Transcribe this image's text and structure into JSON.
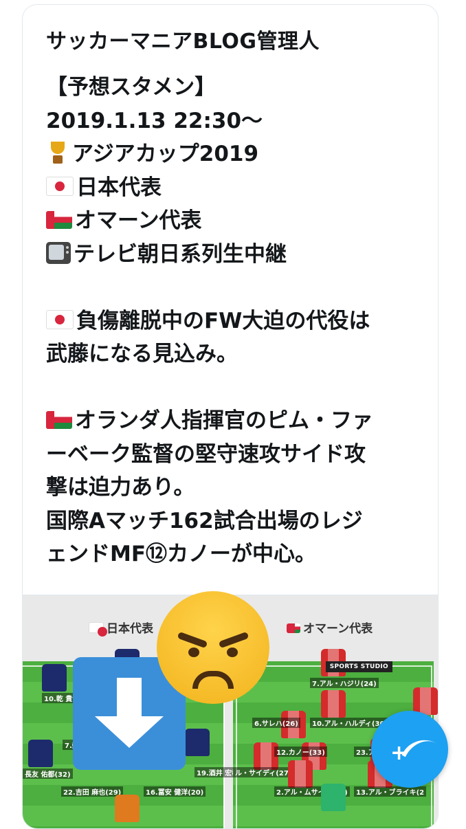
{
  "tweet": {
    "author_name": "サッカーマニアBLOG管理人",
    "lines": [
      {
        "emoji": "",
        "text": "【予想スタメン】"
      },
      {
        "emoji": "",
        "text": "2019.1.13 22:30〜"
      },
      {
        "emoji": "trophy-icon",
        "text": "アジアカップ2019"
      },
      {
        "emoji": "japan-flag-icon",
        "text": "日本代表"
      },
      {
        "emoji": "oman-flag-icon",
        "text": "オマーン代表"
      },
      {
        "emoji": "television-icon",
        "text": "テレビ朝日系列生中継"
      },
      {
        "emoji": "japan-flag-icon",
        "text": "負傷離脱中のFW大迫の代役は"
      },
      {
        "emoji": "",
        "text": "武藤になる見込み。"
      },
      {
        "emoji": "oman-flag-icon",
        "text": "オランダ人指揮官のピム・ファ"
      },
      {
        "emoji": "",
        "text": "ーベーク監督の堅守速攻サイド攻"
      },
      {
        "emoji": "",
        "text": "撃は迫力あり。"
      },
      {
        "emoji": "",
        "text": "国際Aマッチ162試合出場のレジ"
      },
      {
        "emoji": "",
        "text": "ェンドMF⑫カノーが中心。"
      }
    ]
  },
  "lineup_image": {
    "japan_label": "日本代表",
    "oman_label": "オマーン代表",
    "brand_label": "SPORTS STUDIO",
    "japan_players": [
      "10.乾 貴士(30)",
      "7.柴",
      "長友 佑都(32)",
      "22.吉田 麻也(29)",
      "16.冨安 健洋(20)",
      "19.酒井 宏樹"
    ],
    "oman_players": [
      "7.アル・ハジリ(24)",
      "6.サレハ(26)",
      "10.アル・ハルディ(30)",
      "12.カノー(33)",
      "23.アル",
      "ル・サイディ(27)",
      "2.アル・ムサイニ(28)",
      "13.アル・ブライキ(2"
    ]
  },
  "overlays": {
    "download_icon": "download-arrow-icon",
    "reaction_icon": "angry-face-icon",
    "compose_icon": "compose-tweet-icon"
  }
}
